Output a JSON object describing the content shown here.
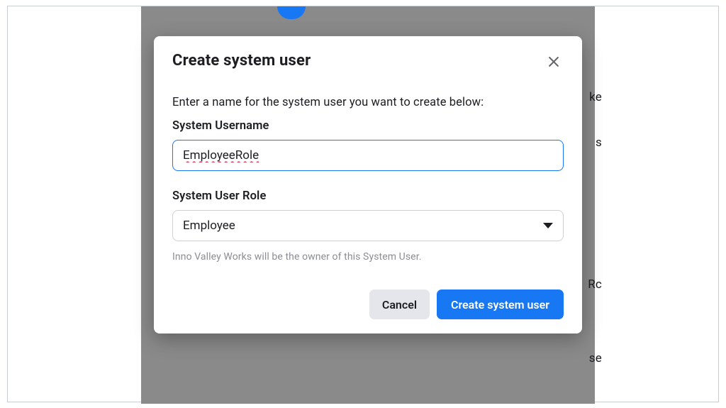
{
  "modal": {
    "title": "Create system user",
    "instruction": "Enter a name for the system user you want to create below:",
    "username_label": "System Username",
    "username_value": "EmployeeRole",
    "role_label": "System User Role",
    "role_value": "Employee",
    "helper_text": "Inno Valley Works will be the owner of this System User.",
    "cancel_label": "Cancel",
    "submit_label": "Create system user"
  },
  "background": {
    "text1": "ke",
    "text2": "s",
    "text3": "Rc",
    "text4": "se"
  }
}
